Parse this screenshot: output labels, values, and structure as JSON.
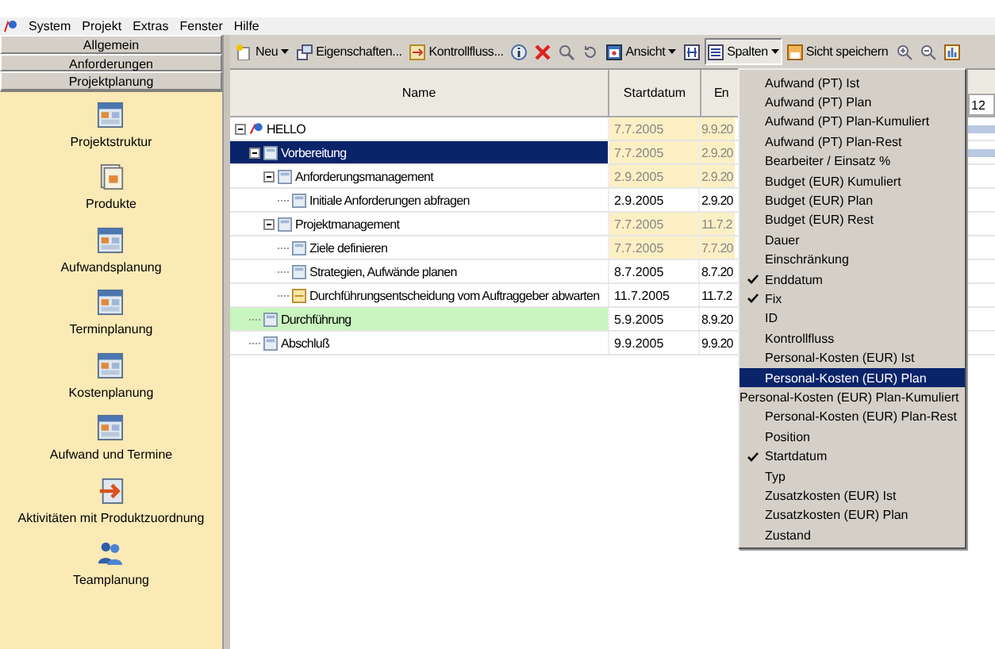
{
  "menu_bar": {
    "items": [
      "System",
      "Projekt",
      "Extras",
      "Fenster",
      "Hilfe"
    ]
  },
  "sidebar": {
    "sections": [
      {
        "label": "Allgemein",
        "selected": false
      },
      {
        "label": "Anforderungen",
        "selected": false
      },
      {
        "label": "Projektplanung",
        "selected": true
      }
    ],
    "items": [
      {
        "label": "Projektstruktur",
        "kind": "table"
      },
      {
        "label": "Produkte",
        "kind": "documents"
      },
      {
        "label": "Aufwandsplanung",
        "kind": "table"
      },
      {
        "label": "Terminplanung",
        "kind": "table"
      },
      {
        "label": "Kostenplanung",
        "kind": "table"
      },
      {
        "label": "Aufwand und Termine",
        "kind": "table"
      },
      {
        "label": "Aktivitäten mit Produktzuordnung",
        "kind": "arrow"
      },
      {
        "label": "Teamplanung",
        "kind": "team"
      }
    ]
  },
  "toolbar": {
    "items": [
      {
        "kind": "new",
        "label": "Neu",
        "caret": true,
        "pressed": false
      },
      {
        "kind": "properties",
        "label": "Eigenschaften...",
        "caret": false,
        "pressed": false
      },
      {
        "kind": "flow",
        "label": "Kontrollfluss...",
        "caret": false,
        "pressed": false
      },
      {
        "kind": "info",
        "caret": false,
        "pressed": false
      },
      {
        "kind": "delete",
        "caret": false,
        "pressed": false
      },
      {
        "kind": "search",
        "caret": false,
        "pressed": false
      },
      {
        "kind": "refresh",
        "caret": false,
        "pressed": false
      },
      {
        "kind": "view",
        "label": "Ansicht",
        "caret": true,
        "pressed": false
      },
      {
        "kind": "filter",
        "caret": false,
        "pressed": false
      },
      {
        "kind": "columns",
        "label": "Spalten",
        "caret": true,
        "pressed": true
      },
      {
        "kind": "save",
        "label": "Sicht speichern",
        "caret": false,
        "pressed": false
      },
      {
        "kind": "zoom-in",
        "caret": false,
        "pressed": false
      },
      {
        "kind": "zoom-out",
        "caret": false,
        "pressed": false
      },
      {
        "kind": "chart",
        "caret": false,
        "pressed": false
      }
    ]
  },
  "table": {
    "columns": [
      "Name",
      "Startdatum",
      "En"
    ],
    "timeline_header": "12",
    "rows": [
      {
        "name": "HELLO",
        "kind": "project",
        "start": "7.7.2005",
        "end": "9.9.20",
        "selected": false,
        "highlighted": false,
        "dates_highlighted": true,
        "timeline_bar": true,
        "expanded": true,
        "children": [
          {
            "name": "Vorbereitung",
            "kind": "phase",
            "start": "7.7.2005",
            "end": "2.9.20",
            "selected": true,
            "highlighted": false,
            "dates_highlighted": true,
            "timeline_bar": true,
            "expanded": true,
            "children": [
              {
                "name": "Anforderungsmanagement",
                "kind": "phase",
                "start": "2.9.2005",
                "end": "2.9.20",
                "selected": false,
                "highlighted": false,
                "dates_highlighted": true,
                "timeline_bar": false,
                "expanded": true,
                "children": [
                  {
                    "name": "Initiale Anforderungen abfragen",
                    "kind": "task",
                    "start": "2.9.2005",
                    "end": "2.9.20",
                    "selected": false,
                    "highlighted": false,
                    "dates_highlighted": false,
                    "timeline_bar": false
                  }
                ]
              },
              {
                "name": "Projektmanagement",
                "kind": "phase",
                "start": "7.7.2005",
                "end": "11.7.2",
                "selected": false,
                "highlighted": false,
                "dates_highlighted": true,
                "timeline_bar": false,
                "expanded": true,
                "children": [
                  {
                    "name": "Ziele definieren",
                    "kind": "task",
                    "start": "7.7.2005",
                    "end": "7.7.20",
                    "selected": false,
                    "highlighted": false,
                    "dates_highlighted": true,
                    "timeline_bar": false
                  },
                  {
                    "name": "Strategien, Aufwände planen",
                    "kind": "task",
                    "start": "8.7.2005",
                    "end": "8.7.20",
                    "selected": false,
                    "highlighted": false,
                    "dates_highlighted": false,
                    "timeline_bar": false
                  },
                  {
                    "name": "Durchführungsentscheidung vom Auftraggeber abwarten",
                    "kind": "decision",
                    "start": "11.7.2005",
                    "end": "11.7.2",
                    "selected": false,
                    "highlighted": false,
                    "dates_highlighted": false,
                    "timeline_bar": false
                  }
                ]
              }
            ]
          },
          {
            "name": "Durchführung",
            "kind": "phase",
            "start": "5.9.2005",
            "end": "8.9.20",
            "selected": false,
            "highlighted": true,
            "dates_highlighted": false,
            "timeline_bar": false
          },
          {
            "name": "Abschluß",
            "kind": "phase",
            "start": "9.9.2005",
            "end": "9.9.20",
            "selected": false,
            "highlighted": false,
            "dates_highlighted": false,
            "timeline_bar": false
          }
        ]
      }
    ]
  },
  "columns_menu": {
    "items": [
      {
        "label": "Aufwand (PT) Ist",
        "checked": false,
        "selected": false
      },
      {
        "label": "Aufwand (PT) Plan",
        "checked": false,
        "selected": false
      },
      {
        "label": "Aufwand (PT) Plan-Kumuliert",
        "checked": false,
        "selected": false
      },
      {
        "label": "Aufwand (PT) Plan-Rest",
        "checked": false,
        "selected": false
      },
      {
        "label": "Bearbeiter / Einsatz %",
        "checked": false,
        "selected": false
      },
      {
        "label": "Budget (EUR) Kumuliert",
        "checked": false,
        "selected": false
      },
      {
        "label": "Budget (EUR) Plan",
        "checked": false,
        "selected": false
      },
      {
        "label": "Budget (EUR) Rest",
        "checked": false,
        "selected": false
      },
      {
        "label": "Dauer",
        "checked": false,
        "selected": false
      },
      {
        "label": "Einschränkung",
        "checked": false,
        "selected": false
      },
      {
        "label": "Enddatum",
        "checked": true,
        "selected": false
      },
      {
        "label": "Fix",
        "checked": true,
        "selected": false
      },
      {
        "label": "ID",
        "checked": false,
        "selected": false
      },
      {
        "label": "Kontrollfluss",
        "checked": false,
        "selected": false
      },
      {
        "label": "Personal-Kosten (EUR) Ist",
        "checked": false,
        "selected": false
      },
      {
        "label": "Personal-Kosten (EUR) Plan",
        "checked": false,
        "selected": true
      },
      {
        "label": "Personal-Kosten (EUR) Plan-Kumuliert",
        "checked": false,
        "selected": false
      },
      {
        "label": "Personal-Kosten (EUR) Plan-Rest",
        "checked": false,
        "selected": false
      },
      {
        "label": "Position",
        "checked": false,
        "selected": false
      },
      {
        "label": "Startdatum",
        "checked": true,
        "selected": false
      },
      {
        "label": "Typ",
        "checked": false,
        "selected": false
      },
      {
        "label": "Zusatzkosten (EUR) Ist",
        "checked": false,
        "selected": false
      },
      {
        "label": "Zusatzkosten (EUR) Plan",
        "checked": false,
        "selected": false
      },
      {
        "label": "Zustand",
        "checked": false,
        "selected": false
      }
    ]
  }
}
